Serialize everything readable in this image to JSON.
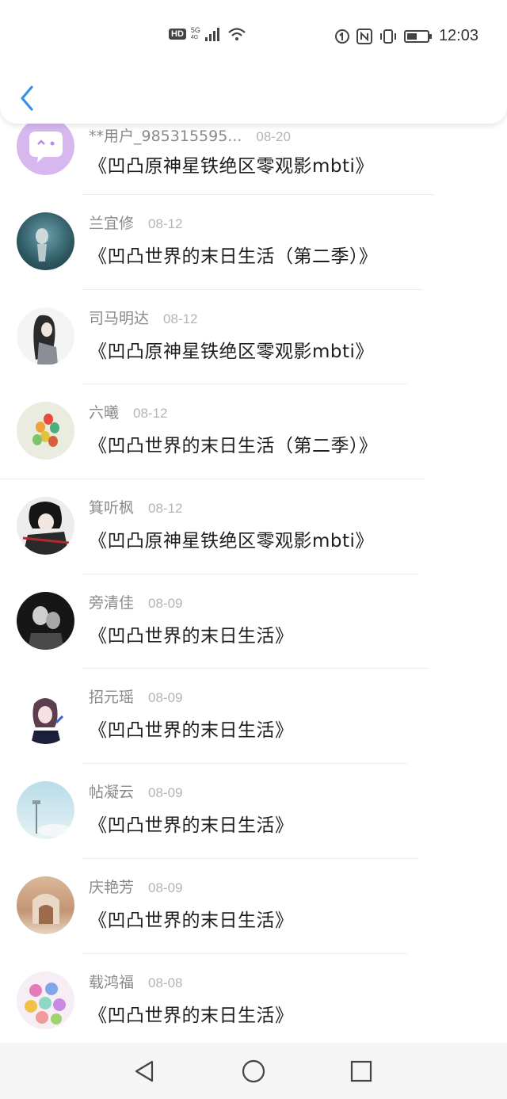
{
  "status_bar": {
    "hd": "HD",
    "network": "5G",
    "network_sub": "4G",
    "time": "12:03"
  },
  "nav": {
    "back_icon": "chevron-left-icon"
  },
  "colors": {
    "accent": "#3a8fe6"
  },
  "comments": [
    {
      "username": "**用户_985315595...",
      "date": "08-20",
      "title": "《凹凸原神星铁绝区零观影mbti》"
    },
    {
      "username": "兰宜修",
      "date": "08-12",
      "title": "《凹凸世界的末日生活（第二季）》"
    },
    {
      "username": "司马明达",
      "date": "08-12",
      "title": "《凹凸原神星铁绝区零观影mbti》"
    },
    {
      "username": "六曦",
      "date": "08-12",
      "title": "《凹凸世界的末日生活（第二季）》"
    },
    {
      "username": "箕听枫",
      "date": "08-12",
      "title": "《凹凸原神星铁绝区零观影mbti》"
    },
    {
      "username": "旁清佳",
      "date": "08-09",
      "title": "《凹凸世界的末日生活》"
    },
    {
      "username": "招元瑶",
      "date": "08-09",
      "title": "《凹凸世界的末日生活》"
    },
    {
      "username": "帖凝云",
      "date": "08-09",
      "title": "《凹凸世界的末日生活》"
    },
    {
      "username": "庆艳芳",
      "date": "08-09",
      "title": "《凹凸世界的末日生活》"
    },
    {
      "username": "载鸿福",
      "date": "08-08",
      "title": "《凹凸世界的末日生活》"
    }
  ]
}
